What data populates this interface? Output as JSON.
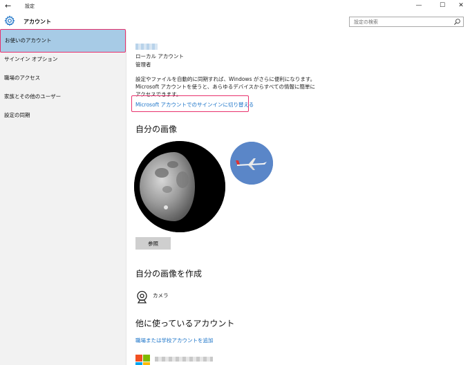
{
  "window": {
    "title": "設定",
    "back_glyph": "←",
    "minimize_glyph": "—",
    "maximize_glyph": "☐",
    "close_glyph": "✕"
  },
  "header": {
    "app_title": "アカウント",
    "search_placeholder": "設定の検索",
    "icon": "gear-icon"
  },
  "sidebar": {
    "items": [
      {
        "label": "お使いのアカウント",
        "selected": true
      },
      {
        "label": "サインイン オプション",
        "selected": false
      },
      {
        "label": "職場のアクセス",
        "selected": false
      },
      {
        "label": "家族とその他のユーザー",
        "selected": false
      },
      {
        "label": "設定の同期",
        "selected": false
      }
    ]
  },
  "account": {
    "type": "ローカル アカウント",
    "role": "管理者",
    "description": "設定やファイルを自動的に同期すれば、Windows がさらに便利になります。Microsoft アカウントを使うと、あらゆるデバイスからすべての情報に簡単にアクセスできます。",
    "switch_link": "Microsoft アカウントでのサインインに切り替える"
  },
  "picture": {
    "heading": "自分の画像",
    "browse_label": "参照"
  },
  "create_picture": {
    "heading": "自分の画像を作成",
    "camera_label": "カメラ",
    "camera_icon": "webcam-icon"
  },
  "other_accounts": {
    "heading": "他に使っているアカウント",
    "add_link": "職場または学校アカウントを追加",
    "logo_colors": [
      "#f25022",
      "#7fba00",
      "#00a4ef",
      "#ffb900"
    ]
  },
  "colors": {
    "accent_link": "#1a73c8",
    "selected_bg": "#a7cbe6",
    "highlight_border": "#e8306c",
    "sidebar_bg": "#f2f2f2"
  }
}
